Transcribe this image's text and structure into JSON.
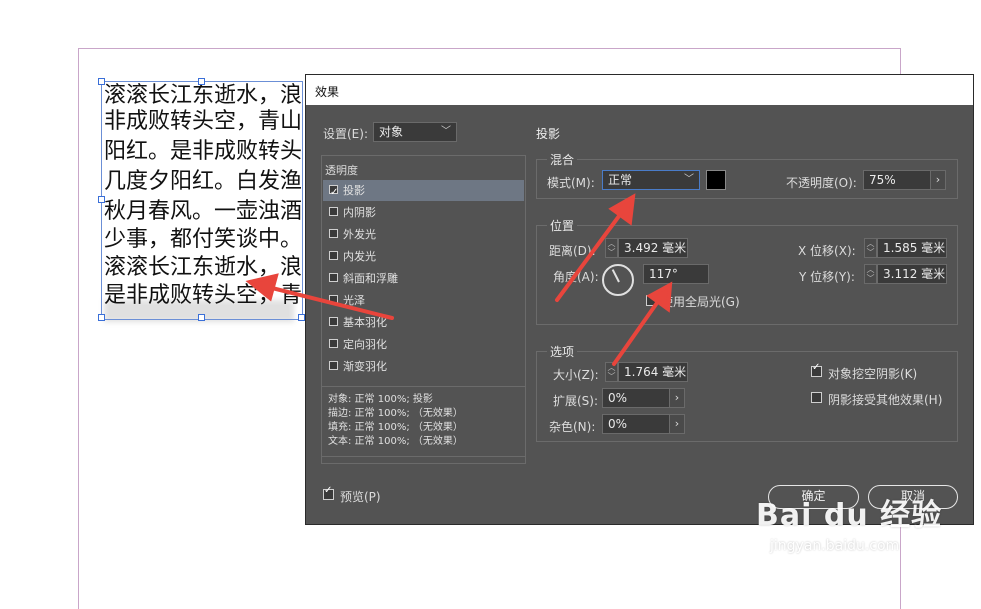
{
  "document": {
    "lines": [
      "滚滚长江东逝水，浪",
      "非成败转头空，青山",
      "阳红。是非成败转头",
      "几度夕阳红。白发渔",
      "秋月春风。一壶浊酒",
      "少事，都付笑谈中。",
      "滚滚长江东逝水，浪",
      "是非成败转头空，青"
    ]
  },
  "dialog": {
    "title": "效果",
    "settings_label": "设置(E):",
    "settings_value": "对象",
    "section_title": "投影",
    "effects_list": {
      "header": "透明度",
      "items": [
        {
          "label": "投影",
          "checked": true,
          "selected": true
        },
        {
          "label": "内阴影",
          "checked": false,
          "selected": false
        },
        {
          "label": "外发光",
          "checked": false,
          "selected": false
        },
        {
          "label": "内发光",
          "checked": false,
          "selected": false
        },
        {
          "label": "斜面和浮雕",
          "checked": false,
          "selected": false
        },
        {
          "label": "光泽",
          "checked": false,
          "selected": false
        },
        {
          "label": "基本羽化",
          "checked": false,
          "selected": false
        },
        {
          "label": "定向羽化",
          "checked": false,
          "selected": false
        },
        {
          "label": "渐变羽化",
          "checked": false,
          "selected": false
        }
      ]
    },
    "summary": [
      "对象: 正常 100%; 投影",
      "描边: 正常 100%; （无效果）",
      "填充: 正常 100%; （无效果）",
      "文本: 正常 100%; （无效果）"
    ],
    "blend": {
      "title": "混合",
      "mode_label": "模式(M):",
      "mode_value": "正常",
      "color": "#000000",
      "opacity_label": "不透明度(O):",
      "opacity_value": "75%"
    },
    "position": {
      "title": "位置",
      "distance_label": "距离(D):",
      "distance_value": "3.492 毫米",
      "angle_label": "角度(A):",
      "angle_value": "117°",
      "global_light_label": "使用全局光(G)",
      "global_light_checked": false,
      "x_offset_label": "X 位移(X):",
      "x_offset_value": "1.585 毫米",
      "y_offset_label": "Y 位移(Y):",
      "y_offset_value": "3.112 毫米"
    },
    "options": {
      "title": "选项",
      "size_label": "大小(Z):",
      "size_value": "1.764 毫米",
      "spread_label": "扩展(S):",
      "spread_value": "0%",
      "noise_label": "杂色(N):",
      "noise_value": "0%",
      "knockout_label": "对象挖空阴影(K)",
      "knockout_checked": true,
      "honor_label": "阴影接受其他效果(H)",
      "honor_checked": false
    },
    "preview_label": "预览(P)",
    "preview_checked": true,
    "ok_label": "确定",
    "cancel_label": "取消"
  },
  "watermark": {
    "brand": "Bai du 经验",
    "url": "jingyan.baidu.com"
  },
  "colors": {
    "dialog_bg": "#535353",
    "arrow": "#e8453c",
    "selection": "#6e7784"
  }
}
